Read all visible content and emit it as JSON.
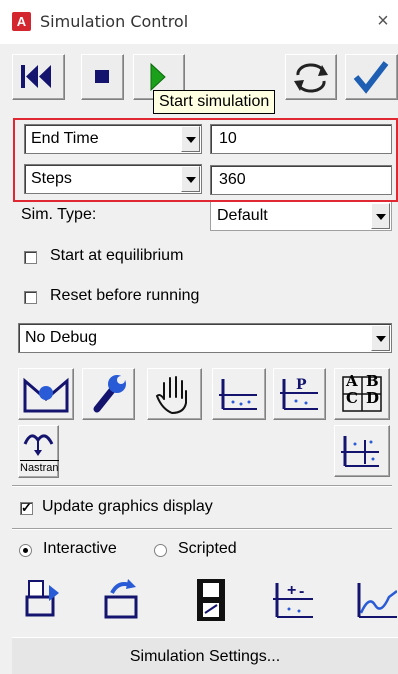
{
  "window": {
    "app_icon_letter": "A",
    "title": "Simulation Control",
    "close_glyph": "×"
  },
  "toolbar": {
    "buttons": [
      {
        "icon": "rewind-to-start-icon"
      },
      {
        "icon": "stop-icon"
      },
      {
        "icon": "play-icon"
      },
      {
        "icon": "cycle-refresh-icon"
      },
      {
        "icon": "checkmark-icon"
      }
    ],
    "tooltip": "Start simulation"
  },
  "sim_params": {
    "row1": {
      "selector": "End Time",
      "value": "10"
    },
    "row2": {
      "selector": "Steps",
      "value": "360"
    }
  },
  "sim_type": {
    "label": "Sim. Type:",
    "value": "Default"
  },
  "options": {
    "start_at_equilibrium": {
      "label": "Start at equilibrium",
      "checked": false
    },
    "reset_before_running": {
      "label": "Reset before running",
      "checked": false
    }
  },
  "debug": {
    "value": "No Debug"
  },
  "tool_icons": [
    "model-view-icon",
    "wrench-icon",
    "hand-icon",
    "plot-axes-icon",
    "plot-peak-icon",
    "abcd-table-icon",
    "nastran-icon",
    "plot-scatter-icon"
  ],
  "nastran_label": "Nastran",
  "abcd": [
    "A",
    "B",
    "C",
    "D"
  ],
  "update_graphics": {
    "label": "Update graphics display",
    "checked": true
  },
  "mode": {
    "interactive": "Interactive",
    "scripted": "Scripted",
    "selected": "interactive"
  },
  "bottom_icons": [
    "load-script-icon",
    "load-folder-icon",
    "film-icon",
    "plot-plusminus-icon",
    "curve-plot-icon"
  ],
  "settings_button": "Simulation Settings...",
  "colors": {
    "accent_red": "#e02833",
    "check_blue": "#1e5fb4",
    "play_green": "#1aa01a"
  }
}
